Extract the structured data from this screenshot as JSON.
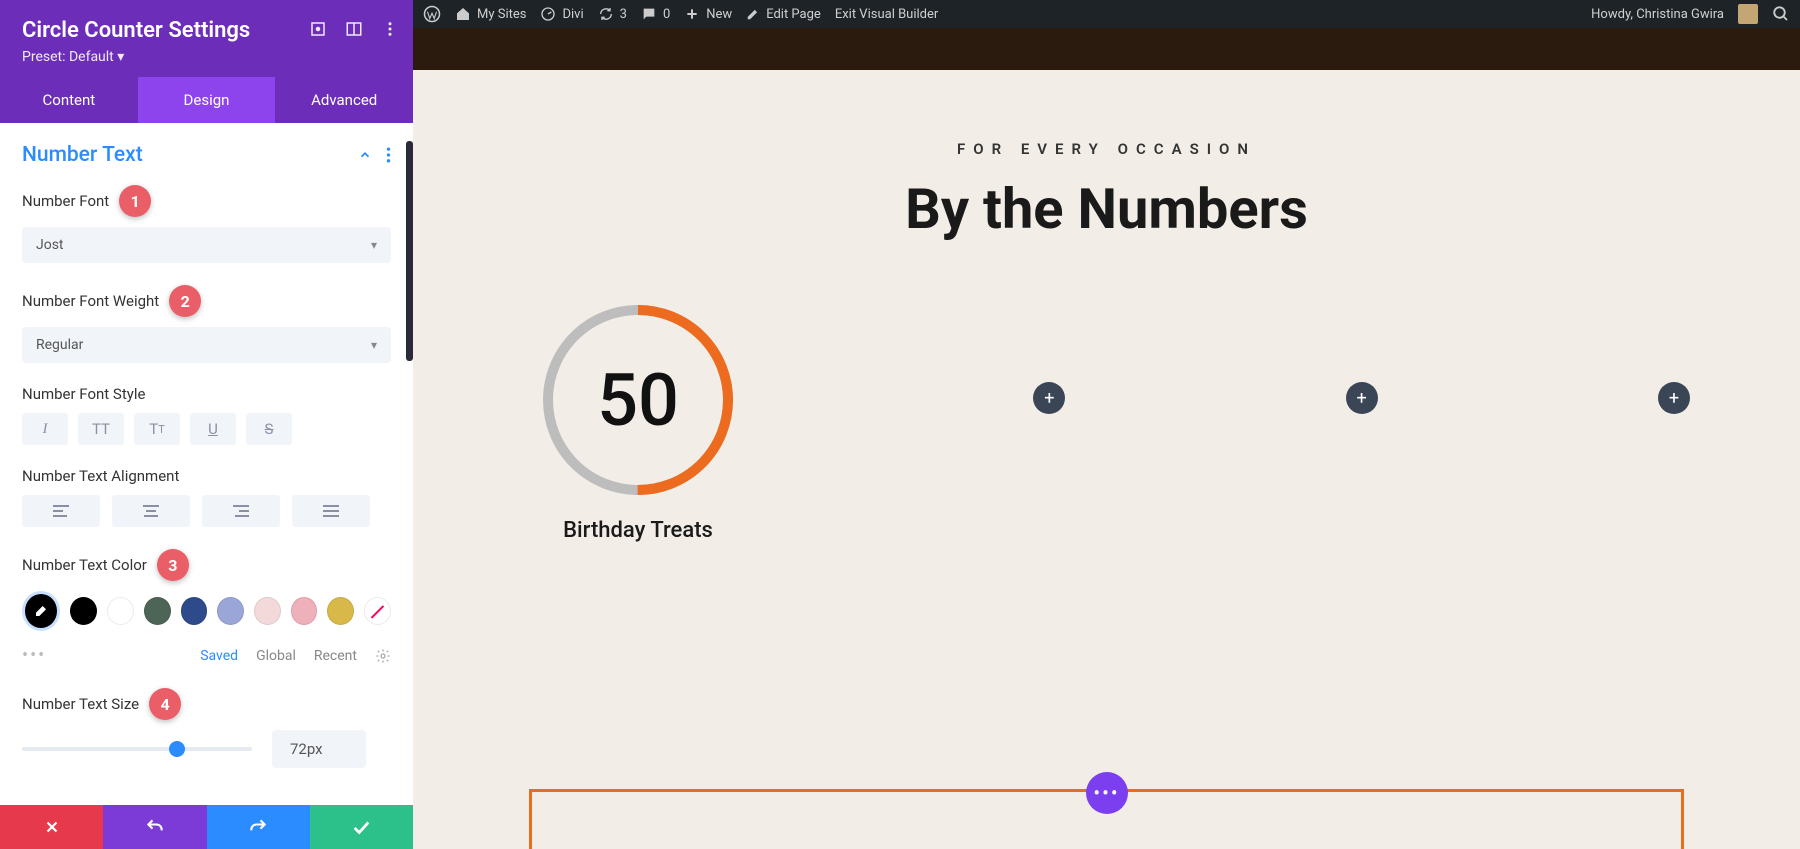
{
  "sidebar": {
    "title": "Circle Counter Settings",
    "preset": "Preset: Default ▾",
    "tabs": {
      "content": "Content",
      "design": "Design",
      "advanced": "Advanced"
    },
    "section": "Number Text",
    "fields": {
      "font_label": "Number Font",
      "font_value": "Jost",
      "weight_label": "Number Font Weight",
      "weight_value": "Regular",
      "style_label": "Number Font Style",
      "align_label": "Number Text Alignment",
      "color_label": "Number Text Color",
      "size_label": "Number Text Size",
      "size_value": "72px"
    },
    "badges": {
      "b1": "1",
      "b2": "2",
      "b3": "3",
      "b4": "4"
    },
    "color_sub": {
      "saved": "Saved",
      "global": "Global",
      "recent": "Recent"
    },
    "swatches": [
      "#000000",
      "#ffffff",
      "#4d6556",
      "#2d4a8a",
      "#9aa6d8",
      "#f4d9db",
      "#eeb0bb",
      "#d9b84a"
    ]
  },
  "wpbar": {
    "mysites": "My Sites",
    "divi": "Divi",
    "updates": "3",
    "comments": "0",
    "new": "New",
    "edit": "Edit Page",
    "exit": "Exit Visual Builder",
    "howdy": "Howdy, Christina Gwira"
  },
  "canvas": {
    "subhead": "FOR EVERY OCCASION",
    "headline": "By the Numbers",
    "counter_number": "50",
    "counter_caption": "Birthday Treats",
    "circle_percent": 50,
    "colors": {
      "accent": "#ec6b1f",
      "track": "#bdbdbd"
    }
  }
}
